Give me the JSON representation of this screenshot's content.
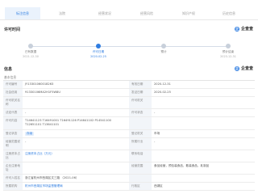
{
  "tabs": [
    {
      "label": "标注信息",
      "active": true
    },
    {
      "label": "法院",
      "active": false
    },
    {
      "label": "经营状况",
      "active": false
    },
    {
      "label": "经营风险",
      "active": false
    },
    {
      "label": "知识产权",
      "active": false
    },
    {
      "label": "历史信息",
      "active": false
    }
  ],
  "timeline_section": {
    "title": "许可时间",
    "enlarge_label": "企查查",
    "nodes": [
      {
        "label": "已有数据",
        "date": "2021-12-30",
        "active": false
      },
      {
        "label": "许可日期",
        "date": "2020-02-25",
        "active": true
      },
      {
        "label": "预计",
        "date": "",
        "active": false
      },
      {
        "label": "预计结束",
        "date": "2023-12-31",
        "active": false
      }
    ]
  },
  "info_section": {
    "title": "信息",
    "enlarge_label": "企查查",
    "subtitle": "基本信息"
  },
  "table": {
    "rows": [
      {
        "l1": "许可编号",
        "v1": "JY13301060018263",
        "l2": "有效日期",
        "v2": "2020-12-31"
      },
      {
        "l1": "社会信用",
        "v1": "91330106MA2H1F5W8U",
        "l2": "发证日期",
        "v2": "2020-02-25"
      },
      {
        "l1": "许可机关名称",
        "v1": "",
        "l2": "许可机关",
        "v2": ""
      },
      {
        "l1": "法定代表",
        "v1": "-",
        "l2": "许可状态",
        "v2": "-"
      },
      {
        "l1": "许可内容",
        "v1": "T14641123 T16491001 T16491126 P14641102 P14541100 T12651101 T13641101",
        "l2": "",
        "v2": ""
      },
      {
        "l1": "登记状态",
        "v1": "存续",
        "l2": "登记机关",
        "v2": "市场"
      },
      {
        "l1": "经营范围说明",
        "v1": "-",
        "l2": "所属行业",
        "v2": "-"
      },
      {
        "l1": "注册资本占比",
        "v1": "注册资本占比（万元）",
        "l2": "联系电话",
        "v2": ""
      },
      {
        "l1": "企业注册地址",
        "v1": "",
        "l2": "经营范围",
        "v2": "食品经营，预包装食品，散装食品，乳制品"
      },
      {
        "l1": "许可人姓名",
        "v1": "浙江省杭州市西湖区文三路 （2021-06）",
        "l2": "",
        "v2": ""
      },
      {
        "l1": "所属机构",
        "v1": "杭州市西湖区市场监督管理局",
        "l2": "行政区",
        "v2": "西湖区"
      }
    ]
  }
}
